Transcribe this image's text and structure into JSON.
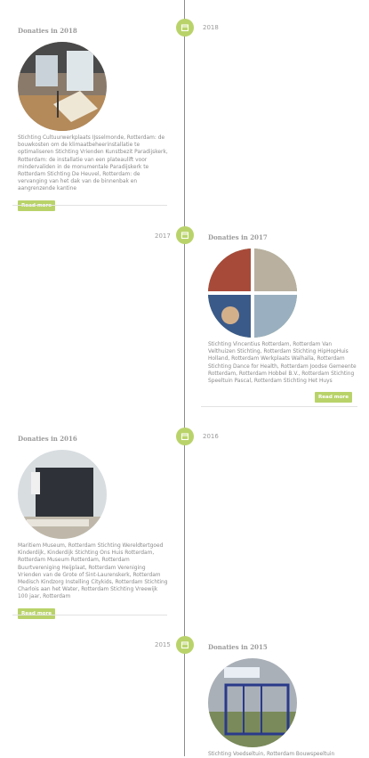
{
  "accent_color": "#b9d36a",
  "icon": "calendar-icon",
  "entries": [
    {
      "year": "2018",
      "title": "Donaties in 2018",
      "description": "Stichting Cultuurwerkplaats IJsselmonde, Rotterdam: de bouwkosten om de klimaatbeheerinstallatie te optimaliseren Stichting Vrienden Kunstbezit Paradijskerk, Rotterdam: de installatie van een plateaulift voor mindervaliden in de monumentale Paradijskerk te Rotterdam Stichting De Heuvel, Rotterdam: de vervanging van het dak van de binnenbak en aangrenzende kantine",
      "button": "Read more"
    },
    {
      "year": "2017",
      "title": "Donaties in 2017",
      "description": "Stichting Vincentius Rotterdam, Rotterdam Van Velthuizen Stichting, Rotterdam Stichting HipHopHuis Holland, Rotterdam Werkplaats Walhalla, Rotterdam Stichting Dance for Health, Rotterdam Joodse Gemeente Rotterdam, Rotterdam Hobbel B.V., Rotterdam Stichting Speeltuin Pascal, Rotterdam Stichting Het Huys",
      "button": "Read more"
    },
    {
      "year": "2016",
      "title": "Donaties in 2016",
      "description": "Maritiem Museum, Rotterdam Stichting Wereldtertgoed Kinderdijk, Kinderdijk Stichting Ons Huis Rotterdam, Rotterdam Museum Rotterdam, Rotterdam Buurtvereniging Heijplaat, Rotterdam Vereniging Vrienden van de Grote of Sint-Laurenskerk, Rotterdam Medisch Kindzorg Instelling Citykids, Rotterdam Stichting Charlois aan het Water, Rotterdam Stichting Vreewijk 100 jaar, Rotterdam",
      "button": "Read more"
    },
    {
      "year": "2015",
      "title": "Donaties in 2015",
      "description": "Stichting Voedseltuin, Rotterdam Bouwspeeltuin",
      "button": ""
    }
  ]
}
